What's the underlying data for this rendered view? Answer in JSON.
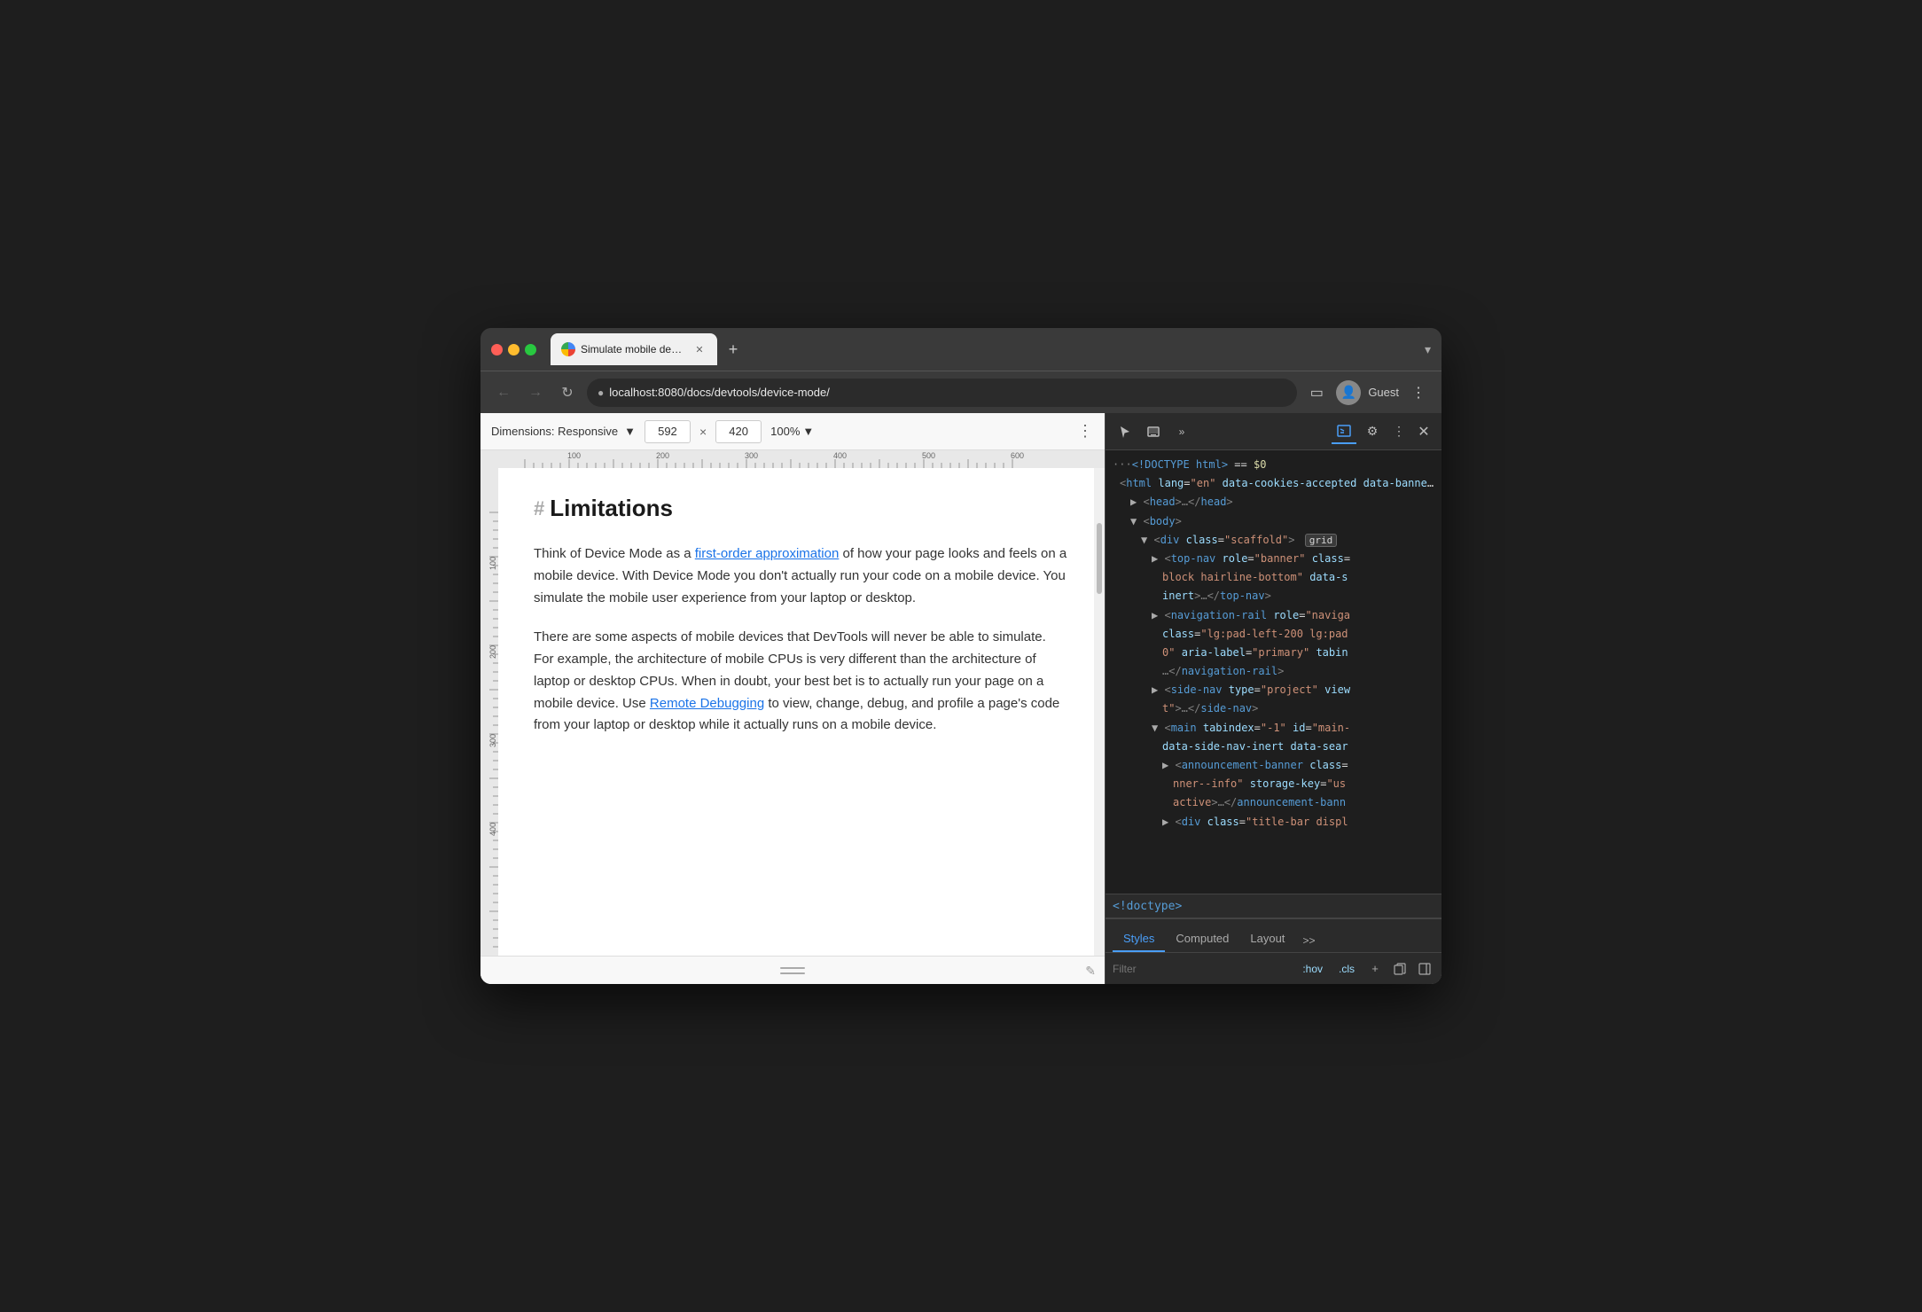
{
  "window": {
    "title": "Simulate mobile devices with D",
    "tab_title": "Simulate mobile devices with D",
    "new_tab_label": "+",
    "chevron": "▾"
  },
  "address_bar": {
    "url": "localhost:8080/docs/devtools/device-mode/",
    "back_label": "‹",
    "forward_label": "›",
    "refresh_label": "↺",
    "lock_icon": "🔒",
    "user_icon": "👤",
    "guest_label": "Guest",
    "menu_icon": "⋮",
    "sidebar_icon": "▭"
  },
  "device_toolbar": {
    "dimensions_label": "Dimensions: Responsive",
    "width_value": "592",
    "height_value": "420",
    "separator": "×",
    "zoom_label": "100%",
    "more_icon": "⋮"
  },
  "page": {
    "heading": "Limitations",
    "anchor": "#",
    "paragraph1_before_link": "Think of Device Mode as a ",
    "paragraph1_link_text": "first-order approximation",
    "paragraph1_after_link": " of how your page looks and feels on a mobile device. With Device Mode you don't actually run your code on a mobile device. You simulate the mobile user experience from your laptop or desktop.",
    "paragraph2_before_link": "There are some aspects of mobile devices that DevTools will never be able to simulate. For example, the architecture of mobile CPUs is very different than the architecture of laptop or desktop CPUs. When in doubt, your best bet is to actually run your page on a mobile device. Use ",
    "paragraph2_link_text": "Remote Debugging",
    "paragraph2_after_link": " to view, change, debug, and profile a page's code from your laptop or desktop while it actually runs on a mobile device."
  },
  "devtools": {
    "toolbar_icons": {
      "cursor_icon": "↖",
      "device_icon": "⬜",
      "more_icon": "»",
      "console_icon": "≡",
      "gear_icon": "⚙",
      "dots_icon": "⋮",
      "close_icon": "✕"
    },
    "code_lines": [
      {
        "indent": 0,
        "content": "···<!DOCTYPE html> == $0",
        "type": "comment"
      },
      {
        "indent": 1,
        "content": "<html lang=\"en\" data-cookies-accepted data-banner-dismissed>",
        "type": "tag"
      },
      {
        "indent": 2,
        "content": "▶ <head>…</head>",
        "type": "tag-collapsed"
      },
      {
        "indent": 2,
        "content": "▼ <body>",
        "type": "tag-expanded"
      },
      {
        "indent": 3,
        "content": "▼ <div class=\"scaffold\">",
        "type": "tag-expanded",
        "badge": "grid"
      },
      {
        "indent": 4,
        "content": "▶ <top-nav role=\"banner\" class=",
        "type": "tag-clipped"
      },
      {
        "indent": 5,
        "content": "block hairline-bottom\" data-s",
        "type": "content"
      },
      {
        "indent": 5,
        "content": "inert>…</top-nav>",
        "type": "tag"
      },
      {
        "indent": 4,
        "content": "▶ <navigation-rail role=\"naviga",
        "type": "tag-clipped"
      },
      {
        "indent": 5,
        "content": "class=\"lg:pad-left-200 lg:pad",
        "type": "content"
      },
      {
        "indent": 5,
        "content": "0\" aria-label=\"primary\" tabin",
        "type": "content"
      },
      {
        "indent": 5,
        "content": "…</navigation-rail>",
        "type": "tag"
      },
      {
        "indent": 4,
        "content": "▶ <side-nav type=\"project\" view",
        "type": "tag-clipped"
      },
      {
        "indent": 5,
        "content": "t\">…</side-nav>",
        "type": "tag"
      },
      {
        "indent": 4,
        "content": "▼ <main tabindex=\"-1\" id=\"main-",
        "type": "tag-clipped"
      },
      {
        "indent": 5,
        "content": "data-side-nav-inert data-sear",
        "type": "content"
      },
      {
        "indent": 5,
        "content": "▶ <announcement-banner class=",
        "type": "tag-clipped"
      },
      {
        "indent": 6,
        "content": "nner--info\" storage-key=\"us",
        "type": "content"
      },
      {
        "indent": 6,
        "content": "active>…</announcement-bann",
        "type": "content"
      },
      {
        "indent": 5,
        "content": "▶ <div class=\"title-bar displ",
        "type": "tag-clipped"
      }
    ],
    "selected_element": "<!doctype>",
    "tabs": {
      "styles_label": "Styles",
      "computed_label": "Computed",
      "layout_label": "Layout",
      "more_label": ">>"
    },
    "filter": {
      "placeholder": "Filter",
      "hov_label": ":hov",
      "cls_label": ".cls",
      "plus_label": "+"
    }
  },
  "colors": {
    "accent_blue": "#4a9ef8",
    "link_blue": "#1a73e8",
    "tag_blue": "#569cd6",
    "attr_cyan": "#9cdcfe",
    "string_orange": "#ce9178",
    "comment_green": "#6a9955",
    "dark_bg": "#1e1e1e",
    "panel_bg": "#2b2b2b"
  }
}
